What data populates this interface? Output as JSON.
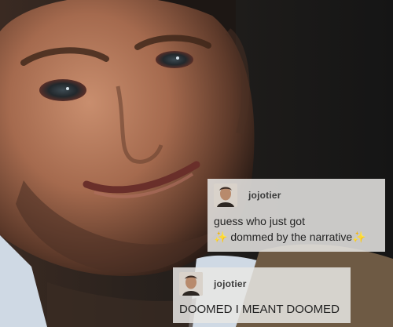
{
  "posts": [
    {
      "username": "jojotier",
      "avatar_icon": "user-portrait-icon",
      "lines": [
        "guess who just got",
        "dommed by the narrative"
      ],
      "sparkle_icon": "sparkles-icon",
      "sparkle_glyph": "✨"
    },
    {
      "username": "jojotier",
      "avatar_icon": "user-portrait-icon",
      "lines": [
        "DOOMED I MEANT DOOMED"
      ]
    }
  ],
  "colors": {
    "post_background": "#e8e6e4",
    "sparkle": "#e9b318"
  }
}
